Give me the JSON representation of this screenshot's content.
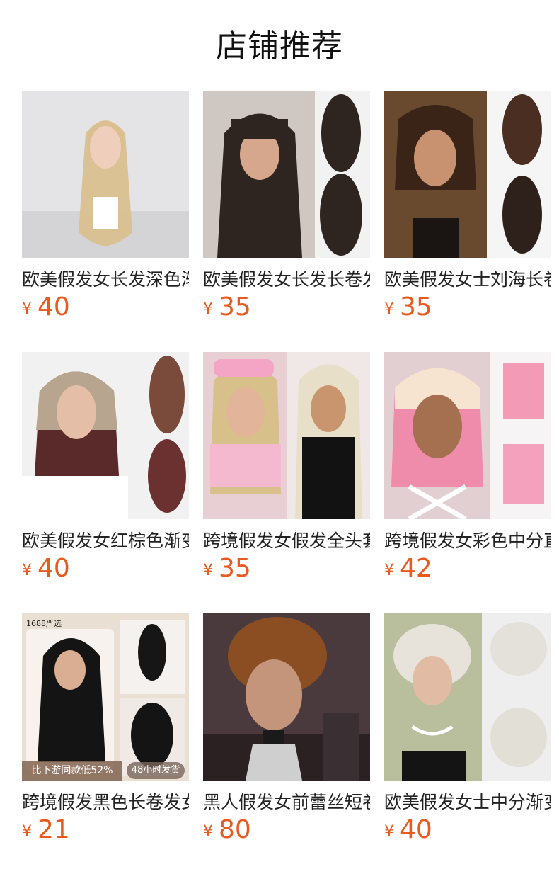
{
  "page": {
    "title": "店铺推荐"
  },
  "currency_symbol": "¥",
  "products": [
    {
      "name": "欧美假发女长发深色渐变",
      "price": "40",
      "image": "blonde-long-wavy-wig-photo"
    },
    {
      "name": "欧美假发女长发长卷发",
      "price": "35",
      "image": "dark-brown-bangs-wavy-wig-photo"
    },
    {
      "name": "欧美假发女士刘海长卷发",
      "price": "35",
      "image": "brown-bangs-long-wig-photo"
    },
    {
      "name": "欧美假发女红棕色渐变",
      "price": "40",
      "image": "ombre-red-brown-wig-photo"
    },
    {
      "name": "跨境假发女假发全头套",
      "price": "35",
      "image": "platinum-blonde-wig-photo"
    },
    {
      "name": "跨境假发女彩色中分直发",
      "price": "42",
      "image": "pink-ombre-bob-wig-photo"
    },
    {
      "name": "跨境假发黑色长卷发女",
      "price": "21",
      "image": "black-long-curly-wig-photo",
      "badges": {
        "top": "1688严选",
        "left": "比下游同款低52%",
        "right": "48小时发货"
      }
    },
    {
      "name": "黑人假发女前蕾丝短卷发",
      "price": "80",
      "image": "curly-lace-front-short-wig-photo"
    },
    {
      "name": "欧美假发女士中分渐变",
      "price": "40",
      "image": "silver-short-curly-wig-photo"
    }
  ]
}
